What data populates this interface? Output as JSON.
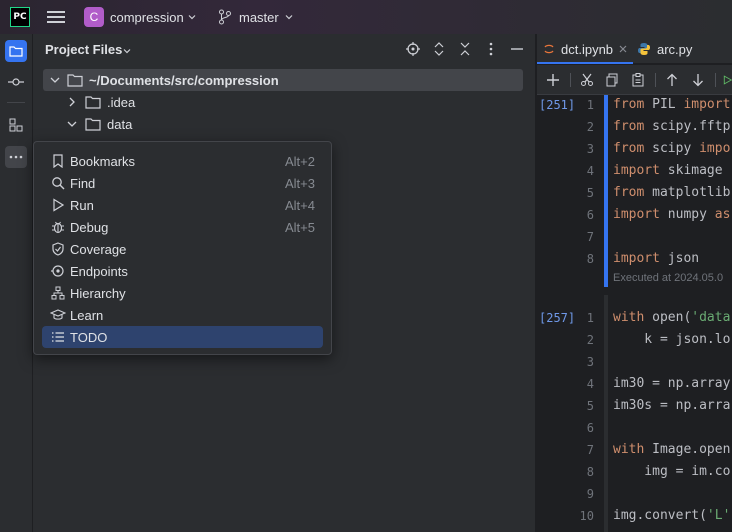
{
  "titlebar": {
    "app_logo": "PC",
    "project_initial": "C",
    "project_name": "compression",
    "branch": "master"
  },
  "panel": {
    "title": "Project Files",
    "tree": {
      "root": "~/Documents/src/compression",
      "items": [
        ".idea",
        "data"
      ]
    }
  },
  "popup": {
    "items": [
      {
        "label": "Bookmarks",
        "shortcut": "Alt+2",
        "icon": "bookmark-icon"
      },
      {
        "label": "Find",
        "shortcut": "Alt+3",
        "icon": "search-icon"
      },
      {
        "label": "Run",
        "shortcut": "Alt+4",
        "icon": "run-icon"
      },
      {
        "label": "Debug",
        "shortcut": "Alt+5",
        "icon": "debug-icon"
      },
      {
        "label": "Coverage",
        "shortcut": "",
        "icon": "coverage-icon"
      },
      {
        "label": "Endpoints",
        "shortcut": "",
        "icon": "endpoints-icon"
      },
      {
        "label": "Hierarchy",
        "shortcut": "",
        "icon": "hierarchy-icon"
      },
      {
        "label": "Learn",
        "shortcut": "",
        "icon": "learn-icon"
      },
      {
        "label": "TODO",
        "shortcut": "",
        "icon": "todo-icon",
        "selected": true
      }
    ]
  },
  "editor": {
    "tabs": [
      {
        "label": "dct.ipynb",
        "active": true
      },
      {
        "label": "arc.py",
        "active": false
      }
    ],
    "cells": [
      {
        "count": "[251]",
        "lines": [
          {
            "n": "1",
            "text": "from PIL import"
          },
          {
            "n": "2",
            "text": "from scipy.fftp"
          },
          {
            "n": "3",
            "text": "from scipy impo"
          },
          {
            "n": "4",
            "text": "import skimage"
          },
          {
            "n": "5",
            "text": "from matplotlib"
          },
          {
            "n": "6",
            "text": "import numpy as"
          },
          {
            "n": "7",
            "text": ""
          },
          {
            "n": "8",
            "text": "import json"
          }
        ],
        "exec_note": "Executed at 2024.05.0"
      },
      {
        "count": "[257]",
        "lines": [
          {
            "n": "1",
            "text": "with open('data"
          },
          {
            "n": "2",
            "text": "    k = json.lo"
          },
          {
            "n": "3",
            "text": ""
          },
          {
            "n": "4",
            "text": "im30 = np.array"
          },
          {
            "n": "5",
            "text": "im30s = np.arra"
          },
          {
            "n": "6",
            "text": ""
          },
          {
            "n": "7",
            "text": "with Image.open"
          },
          {
            "n": "8",
            "text": "    img = im.co"
          },
          {
            "n": "9",
            "text": ""
          },
          {
            "n": "10",
            "text": "img.convert('L'"
          }
        ]
      }
    ]
  },
  "colors": {
    "accent": "#3574f0",
    "selection": "#2e436e",
    "project_badge": "#b15cc9",
    "keyword": "#cf8e6d",
    "string": "#6aab73"
  }
}
